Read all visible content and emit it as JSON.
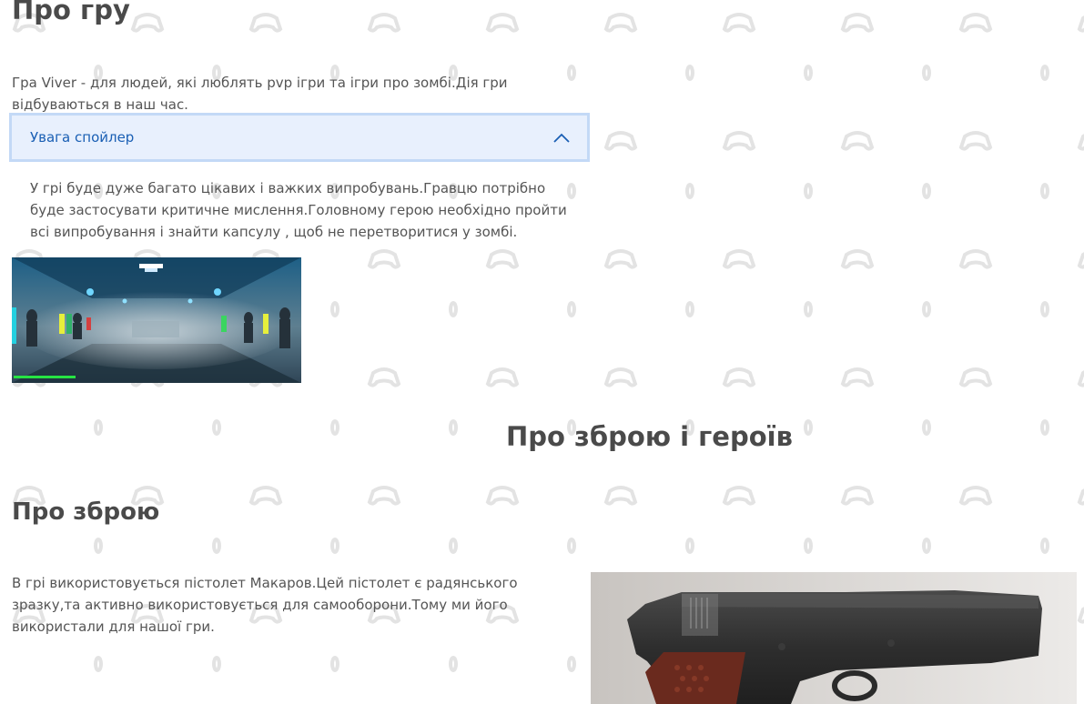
{
  "about_game": {
    "title": "Про гру",
    "intro": "Гра Viver - для людей, які люблять pvp ігри та ігри про зомбі.Дія гри відбуваються в наш час.",
    "spoiler": {
      "label": "Увага спойлер",
      "body": "У грі буде дуже багато цікавих і важких випробувань.Гравцю потрібно буде застосувати критичне мислення.Головному герою необхідно пройти всі випробування і знайти капсулу , щоб не перетворитися у зомбі."
    }
  },
  "weapons_heroes": {
    "title": "Про зброю і героїв"
  },
  "weapons": {
    "title": "Про зброю",
    "text": "В грі використовується пістолет Макаров.Цей пістолет є радянського зразку,та активно використовується для самооборони.Тому ми його використали для нашої гри."
  },
  "colors": {
    "accent": "#1a5fb4",
    "spoiler_bg": "#e8f0fd",
    "spoiler_border": "#c3d9f6",
    "heading": "#4a4a4a"
  },
  "icons": {
    "accordion_toggle": "chevron-up-icon",
    "background": "gamepad-pattern"
  }
}
